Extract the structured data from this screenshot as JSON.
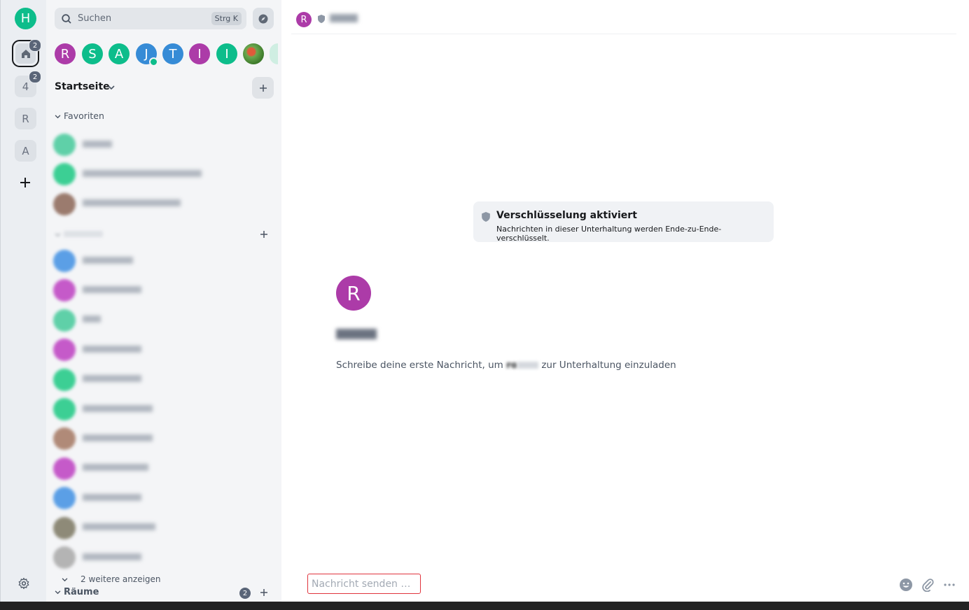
{
  "spaces": {
    "user_avatar": {
      "initial": "H",
      "color": "#0dbd8b"
    },
    "home": {
      "badge": "2"
    },
    "items": [
      {
        "label": "4",
        "badge": "2"
      },
      {
        "label": "R"
      },
      {
        "label": "A"
      }
    ],
    "add_icon": "plus-icon",
    "settings_icon": "gear-icon"
  },
  "roomlist": {
    "search": {
      "placeholder": "Suchen",
      "shortcut": "Strg K"
    },
    "recents": [
      {
        "initial": "R",
        "color": "#ac3ba8"
      },
      {
        "initial": "S",
        "color": "#0dbd8b"
      },
      {
        "initial": "A",
        "color": "#0dbd8b"
      },
      {
        "initial": "J",
        "color": "#368bd6"
      },
      {
        "initial": "T",
        "color": "#368bd6"
      },
      {
        "initial": "I",
        "color": "#ac3ba8"
      },
      {
        "initial": "I",
        "color": "#0dbd8b"
      }
    ],
    "section_title": "Startseite",
    "favorites_label": "Favoriten",
    "favorites_colors": [
      "#5fd0a8",
      "#3ccf94",
      "#9b7b6e"
    ],
    "people_colors": [
      "#5b9fe6",
      "#c55ac9",
      "#5fd0a8",
      "#c55ac9",
      "#3ccf94",
      "#3ccf94",
      "#b08a78",
      "#c55ac9",
      "#5b9fe6",
      "#8e8a78",
      "#b4b4b4"
    ],
    "more_label": "2 weitere anzeigen",
    "rooms_label": "Räume",
    "rooms_badge": "2"
  },
  "main": {
    "header_avatar": "R",
    "encryption": {
      "title": "Verschlüsselung aktiviert",
      "description": "Nachrichten in dieser Unterhaltung werden Ende-zu-Ende-verschlüsselt."
    },
    "big_avatar": "R",
    "intro_before": "Schreibe deine erste Nachricht, um ",
    "intro_name": "ro",
    "intro_after": " zur Unterhaltung einzuladen",
    "composer_placeholder": "Nachricht senden …"
  }
}
